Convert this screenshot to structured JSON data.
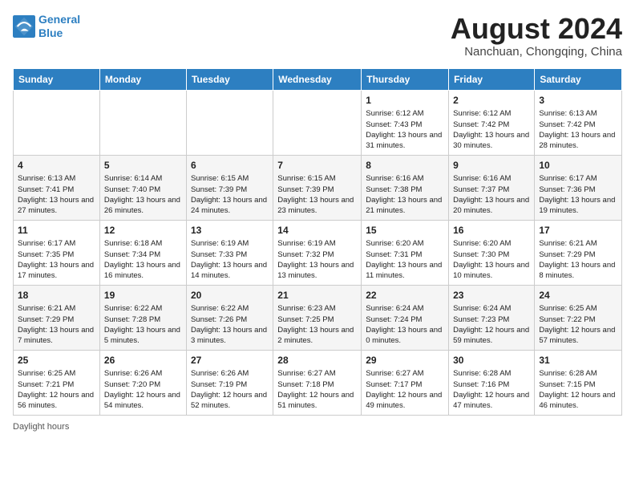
{
  "logo": {
    "line1": "General",
    "line2": "Blue"
  },
  "title": "August 2024",
  "location": "Nanchuan, Chongqing, China",
  "days_of_week": [
    "Sunday",
    "Monday",
    "Tuesday",
    "Wednesday",
    "Thursday",
    "Friday",
    "Saturday"
  ],
  "footer": "Daylight hours",
  "weeks": [
    [
      {
        "day": "",
        "info": ""
      },
      {
        "day": "",
        "info": ""
      },
      {
        "day": "",
        "info": ""
      },
      {
        "day": "",
        "info": ""
      },
      {
        "day": "1",
        "info": "Sunrise: 6:12 AM\nSunset: 7:43 PM\nDaylight: 13 hours and 31 minutes."
      },
      {
        "day": "2",
        "info": "Sunrise: 6:12 AM\nSunset: 7:42 PM\nDaylight: 13 hours and 30 minutes."
      },
      {
        "day": "3",
        "info": "Sunrise: 6:13 AM\nSunset: 7:42 PM\nDaylight: 13 hours and 28 minutes."
      }
    ],
    [
      {
        "day": "4",
        "info": "Sunrise: 6:13 AM\nSunset: 7:41 PM\nDaylight: 13 hours and 27 minutes."
      },
      {
        "day": "5",
        "info": "Sunrise: 6:14 AM\nSunset: 7:40 PM\nDaylight: 13 hours and 26 minutes."
      },
      {
        "day": "6",
        "info": "Sunrise: 6:15 AM\nSunset: 7:39 PM\nDaylight: 13 hours and 24 minutes."
      },
      {
        "day": "7",
        "info": "Sunrise: 6:15 AM\nSunset: 7:39 PM\nDaylight: 13 hours and 23 minutes."
      },
      {
        "day": "8",
        "info": "Sunrise: 6:16 AM\nSunset: 7:38 PM\nDaylight: 13 hours and 21 minutes."
      },
      {
        "day": "9",
        "info": "Sunrise: 6:16 AM\nSunset: 7:37 PM\nDaylight: 13 hours and 20 minutes."
      },
      {
        "day": "10",
        "info": "Sunrise: 6:17 AM\nSunset: 7:36 PM\nDaylight: 13 hours and 19 minutes."
      }
    ],
    [
      {
        "day": "11",
        "info": "Sunrise: 6:17 AM\nSunset: 7:35 PM\nDaylight: 13 hours and 17 minutes."
      },
      {
        "day": "12",
        "info": "Sunrise: 6:18 AM\nSunset: 7:34 PM\nDaylight: 13 hours and 16 minutes."
      },
      {
        "day": "13",
        "info": "Sunrise: 6:19 AM\nSunset: 7:33 PM\nDaylight: 13 hours and 14 minutes."
      },
      {
        "day": "14",
        "info": "Sunrise: 6:19 AM\nSunset: 7:32 PM\nDaylight: 13 hours and 13 minutes."
      },
      {
        "day": "15",
        "info": "Sunrise: 6:20 AM\nSunset: 7:31 PM\nDaylight: 13 hours and 11 minutes."
      },
      {
        "day": "16",
        "info": "Sunrise: 6:20 AM\nSunset: 7:30 PM\nDaylight: 13 hours and 10 minutes."
      },
      {
        "day": "17",
        "info": "Sunrise: 6:21 AM\nSunset: 7:29 PM\nDaylight: 13 hours and 8 minutes."
      }
    ],
    [
      {
        "day": "18",
        "info": "Sunrise: 6:21 AM\nSunset: 7:29 PM\nDaylight: 13 hours and 7 minutes."
      },
      {
        "day": "19",
        "info": "Sunrise: 6:22 AM\nSunset: 7:28 PM\nDaylight: 13 hours and 5 minutes."
      },
      {
        "day": "20",
        "info": "Sunrise: 6:22 AM\nSunset: 7:26 PM\nDaylight: 13 hours and 3 minutes."
      },
      {
        "day": "21",
        "info": "Sunrise: 6:23 AM\nSunset: 7:25 PM\nDaylight: 13 hours and 2 minutes."
      },
      {
        "day": "22",
        "info": "Sunrise: 6:24 AM\nSunset: 7:24 PM\nDaylight: 13 hours and 0 minutes."
      },
      {
        "day": "23",
        "info": "Sunrise: 6:24 AM\nSunset: 7:23 PM\nDaylight: 12 hours and 59 minutes."
      },
      {
        "day": "24",
        "info": "Sunrise: 6:25 AM\nSunset: 7:22 PM\nDaylight: 12 hours and 57 minutes."
      }
    ],
    [
      {
        "day": "25",
        "info": "Sunrise: 6:25 AM\nSunset: 7:21 PM\nDaylight: 12 hours and 56 minutes."
      },
      {
        "day": "26",
        "info": "Sunrise: 6:26 AM\nSunset: 7:20 PM\nDaylight: 12 hours and 54 minutes."
      },
      {
        "day": "27",
        "info": "Sunrise: 6:26 AM\nSunset: 7:19 PM\nDaylight: 12 hours and 52 minutes."
      },
      {
        "day": "28",
        "info": "Sunrise: 6:27 AM\nSunset: 7:18 PM\nDaylight: 12 hours and 51 minutes."
      },
      {
        "day": "29",
        "info": "Sunrise: 6:27 AM\nSunset: 7:17 PM\nDaylight: 12 hours and 49 minutes."
      },
      {
        "day": "30",
        "info": "Sunrise: 6:28 AM\nSunset: 7:16 PM\nDaylight: 12 hours and 47 minutes."
      },
      {
        "day": "31",
        "info": "Sunrise: 6:28 AM\nSunset: 7:15 PM\nDaylight: 12 hours and 46 minutes."
      }
    ]
  ]
}
